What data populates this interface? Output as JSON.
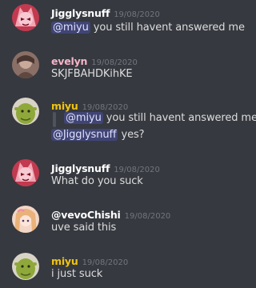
{
  "colors": {
    "background": "#36393f",
    "text": "#dcddde",
    "timestamp": "#72767d",
    "mention_bg": "rgba(88,101,242,0.3)",
    "mention_text": "#dee0fc",
    "name_white": "#ffffff",
    "name_yellow": "#f1c40f",
    "name_pink": "#f5b5c8"
  },
  "messages": [
    {
      "author": "Jigglysnuff",
      "timestamp": "19/08/2020",
      "avatar_icon": "hazbin-character-avatar-icon",
      "mention": "@miyu",
      "text": " you still havent answered me"
    },
    {
      "author": "evelyn",
      "timestamp": "19/08/2020",
      "avatar_icon": "blurred-person-avatar-icon",
      "text": "SKJFBAHDKihKE"
    },
    {
      "author": "miyu",
      "timestamp": "19/08/2020",
      "avatar_icon": "shrek-avatar-icon",
      "quote_mention": "@miyu",
      "quote_text": " you still havent answered me",
      "mention": "@Jigglysnuff",
      "text": " yes?"
    },
    {
      "author": "Jigglysnuff",
      "timestamp": "19/08/2020",
      "avatar_icon": "hazbin-character-avatar-icon",
      "text": "What do you suck"
    },
    {
      "author": "@vevoChishi",
      "timestamp": "19/08/2020",
      "avatar_icon": "anime-girl-avatar-icon",
      "text": "uve said this"
    },
    {
      "author": "miyu",
      "timestamp": "19/08/2020",
      "avatar_icon": "shrek-avatar-icon",
      "text": "i just suck"
    }
  ]
}
